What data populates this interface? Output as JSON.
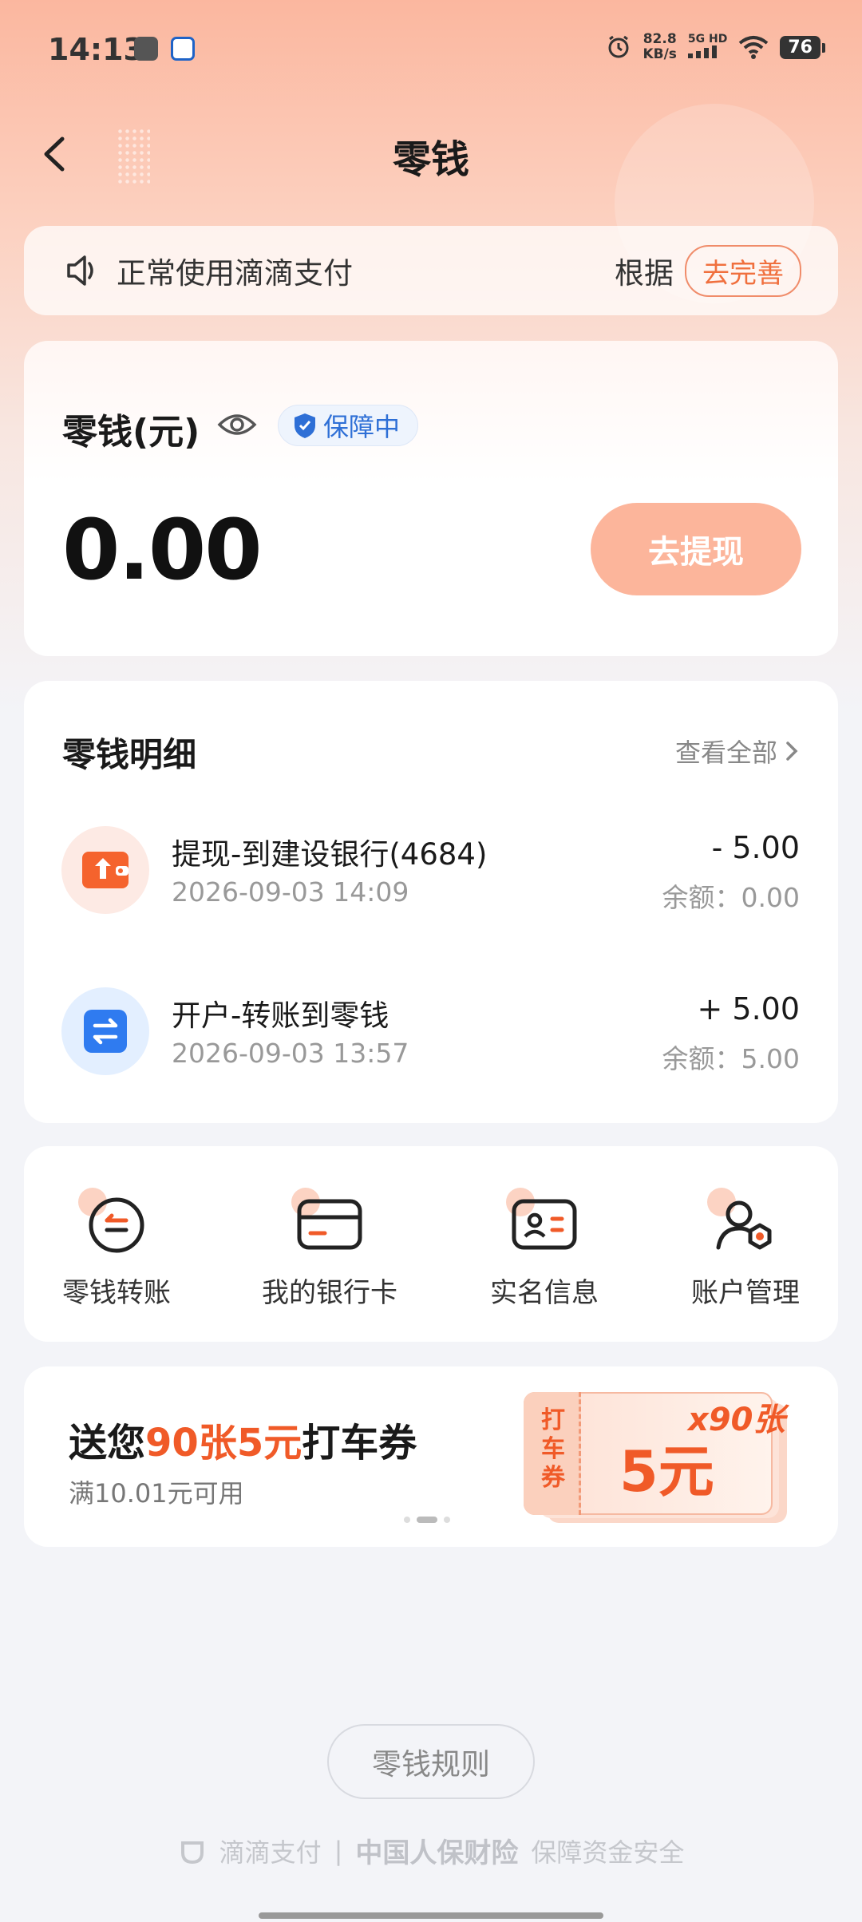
{
  "status_bar": {
    "time": "14:13",
    "speed_value": "82.8",
    "speed_unit": "KB/s",
    "network": "5G HD",
    "battery": "76"
  },
  "header": {
    "title": "零钱"
  },
  "notice": {
    "text": "正常使用滴滴支付",
    "basis": "根据",
    "button": "去完善"
  },
  "balance": {
    "label": "零钱(元)",
    "guard_badge": "保障中",
    "amount": "0.00",
    "withdraw_button": "去提现"
  },
  "details": {
    "title": "零钱明细",
    "view_all": "查看全部",
    "transactions": [
      {
        "title": "提现-到建设银行(4684)",
        "date": "2026-09-03 14:09",
        "amount": "- 5.00",
        "balance": "余额：0.00",
        "icon": "withdraw-icon",
        "icon_color": "#f5632d"
      },
      {
        "title": "开户-转账到零钱",
        "date": "2026-09-03 13:57",
        "amount": "+ 5.00",
        "balance": "余额：5.00",
        "icon": "transfer-icon",
        "icon_color": "#2f7bf0"
      }
    ]
  },
  "actions": [
    {
      "label": "零钱转账",
      "icon": "transfer-circle-icon"
    },
    {
      "label": "我的银行卡",
      "icon": "bank-card-icon"
    },
    {
      "label": "实名信息",
      "icon": "id-card-icon"
    },
    {
      "label": "账户管理",
      "icon": "account-manage-icon"
    }
  ],
  "promo": {
    "title_pre": "送您",
    "title_highlight": "90张5元",
    "title_post": "打车券",
    "subtitle": "满10.01元可用",
    "ticket_side": "打车券",
    "ticket_value": "5元",
    "ticket_count": "x90张"
  },
  "rules_button": "零钱规则",
  "footer": {
    "brand": "滴滴支付",
    "separator": "|",
    "partner": "中国人保财险",
    "slogan": "保障资金安全"
  },
  "colors": {
    "accent": "#f05a28",
    "withdraw_button_bg": "#fcb59b",
    "guard_blue": "#2e6fd6"
  }
}
